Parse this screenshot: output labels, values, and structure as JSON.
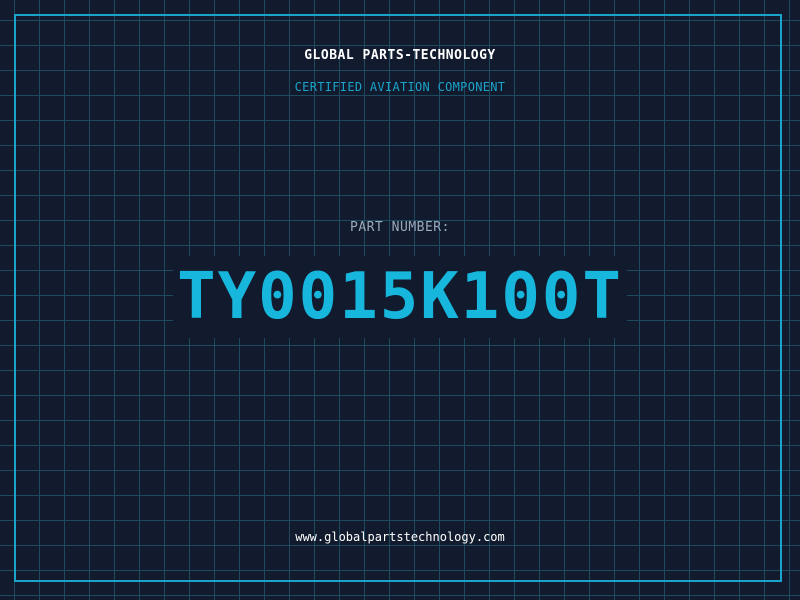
{
  "header": {
    "company": "GLOBAL PARTS-TECHNOLOGY",
    "subtitle": "CERTIFIED AVIATION COMPONENT"
  },
  "part": {
    "label": "PART NUMBER:",
    "number": "TY0015K100T"
  },
  "footer": {
    "url": "www.globalpartstechnology.com"
  },
  "colors": {
    "background": "#121a2e",
    "grid": "#1e4a60",
    "accent": "#1ba3c9",
    "part_number": "#17b6dc"
  }
}
